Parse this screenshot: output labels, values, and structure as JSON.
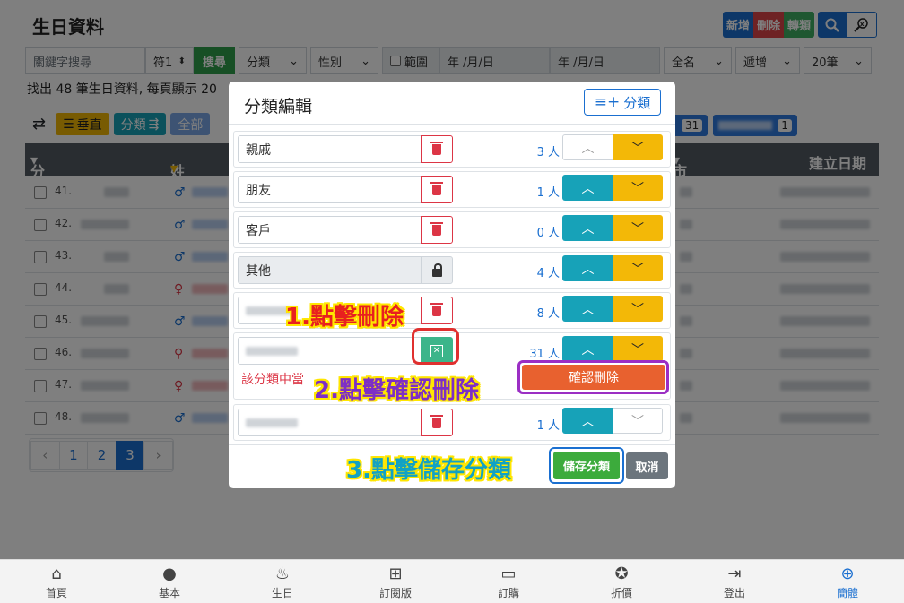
{
  "page": {
    "title": "生日資料",
    "actions": {
      "add": "新增",
      "delete": "刪除",
      "convert": "轉類"
    },
    "filters": {
      "keyword_placeholder": "關鍵字搜尋",
      "match": "符1",
      "search": "搜尋",
      "category": "分類",
      "gender": "性別",
      "range": "範圍",
      "date_from": "年 /月/日",
      "date_to": "年 /月/日",
      "name_mode": "全名",
      "order": "遞增",
      "per_page": "20筆"
    },
    "found_text": "找出 48 筆生日資料, 每頁顯示 20",
    "tags": {
      "vertical": "垂直",
      "category": "分類",
      "all": "全部"
    },
    "right_counts": [
      "31",
      "1"
    ],
    "table_headers": {
      "category": "分類",
      "name": "姓名",
      "city": "市",
      "created": "建立日期"
    },
    "rows": [
      "41.",
      "42.",
      "43.",
      "44.",
      "45.",
      "46.",
      "47.",
      "48."
    ],
    "pagination": [
      "‹",
      "1",
      "2",
      "3",
      "›"
    ]
  },
  "modal": {
    "title": "分類編輯",
    "add_category": "分類",
    "categories": [
      {
        "name": "親戚",
        "count": "3 人"
      },
      {
        "name": "朋友",
        "count": "1 人"
      },
      {
        "name": "客戶",
        "count": "0 人"
      },
      {
        "name": "其他",
        "count": "4 人"
      },
      {
        "name": "",
        "count": "8 人"
      },
      {
        "name": "",
        "count": "31 人"
      },
      {
        "name": "",
        "count": "1 人"
      }
    ],
    "warning": "該分類中當",
    "confirm_delete": "確認刪除",
    "save": "儲存分類",
    "cancel": "取消"
  },
  "annotations": {
    "step1": "1.點擊刪除",
    "step2": "2.點擊確認刪除",
    "step3": "3.點擊儲存分類"
  },
  "bottom_nav": [
    {
      "label": "首頁",
      "icon": "home-icon"
    },
    {
      "label": "基本",
      "icon": "user-icon"
    },
    {
      "label": "生日",
      "icon": "cake-icon"
    },
    {
      "label": "訂閱版",
      "icon": "plus-grid-icon"
    },
    {
      "label": "訂購",
      "icon": "card-icon"
    },
    {
      "label": "折價",
      "icon": "ticket-icon"
    },
    {
      "label": "登出",
      "icon": "logout-icon"
    },
    {
      "label": "簡體",
      "icon": "globe-icon"
    }
  ]
}
